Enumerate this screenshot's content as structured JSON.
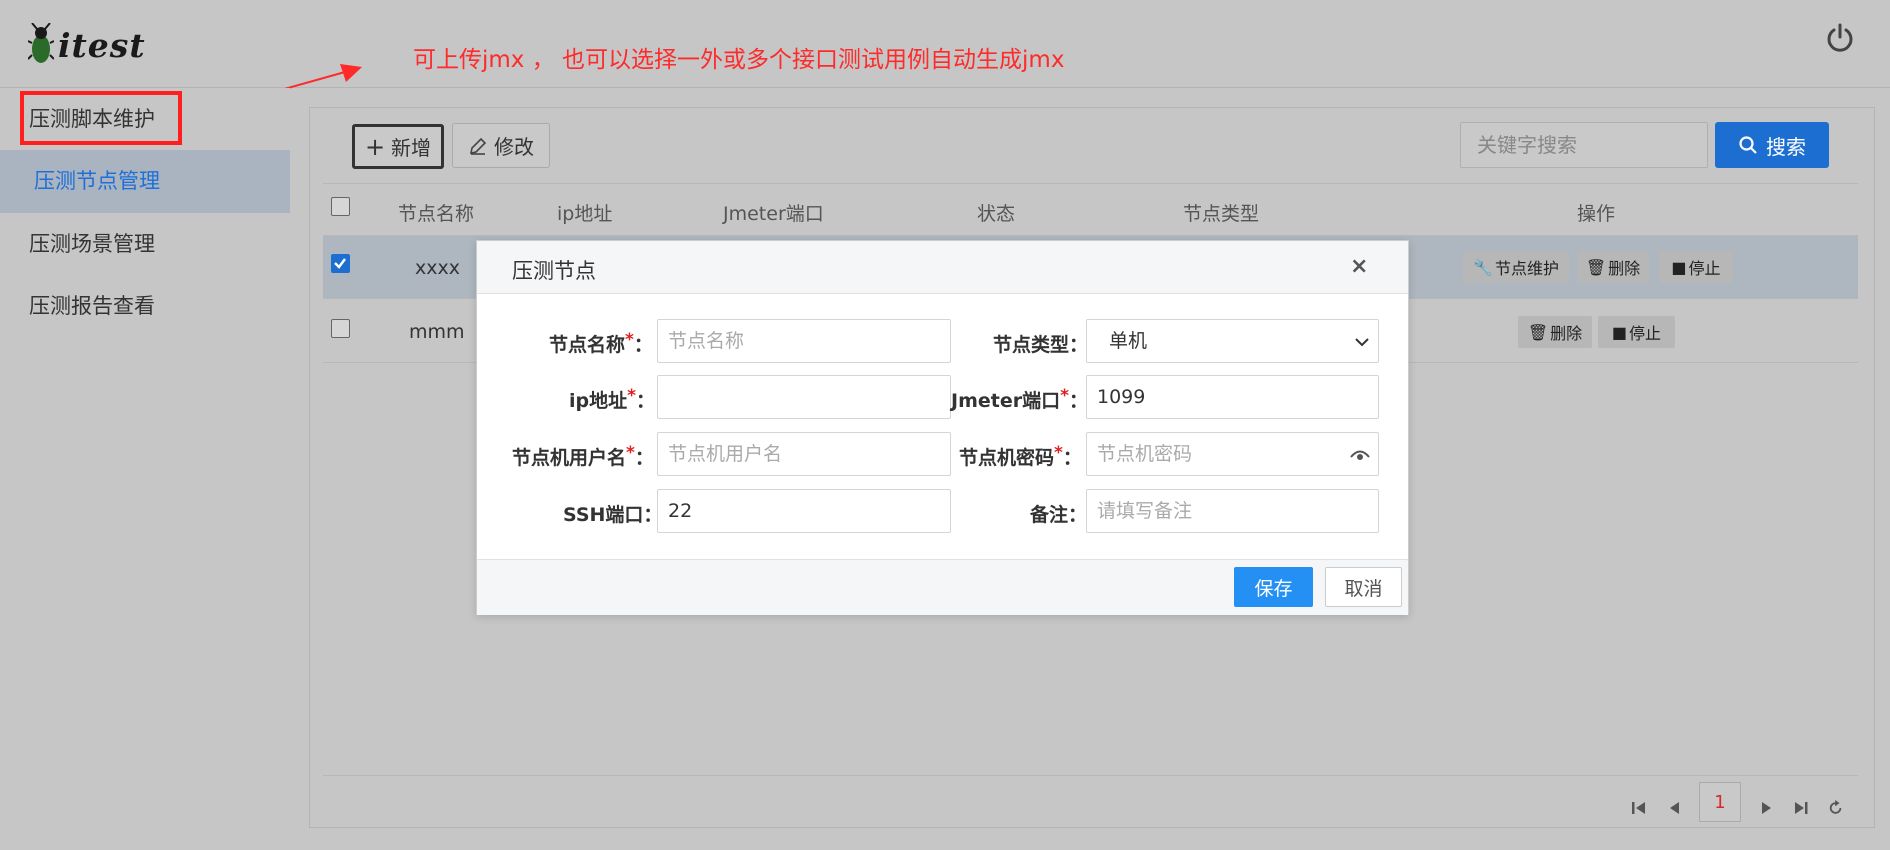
{
  "app": {
    "logo_text": "itest"
  },
  "annotation": {
    "text": "可上传jmx ，  也可以选择一外或多个接口测试用例自动生成jmx",
    "color": "#ff2a2a"
  },
  "sidebar": {
    "items": [
      {
        "label": "压测脚本维护",
        "highlighted": true
      },
      {
        "label": "压测节点管理",
        "active": true
      },
      {
        "label": "压测场景管理"
      },
      {
        "label": "压测报告查看"
      }
    ]
  },
  "toolbar": {
    "add_label": "新增",
    "edit_label": "修改",
    "search_placeholder": "关键字搜索",
    "search_label": "搜索"
  },
  "table": {
    "columns": [
      "节点名称",
      "ip地址",
      "Jmeter端口",
      "状态",
      "节点类型",
      "操作"
    ],
    "rows": [
      {
        "name": "xxxx",
        "checked": true,
        "actions": [
          "节点维护",
          "删除",
          "停止"
        ]
      },
      {
        "name": "mmm",
        "checked": false,
        "actions": [
          "删除",
          "停止"
        ]
      }
    ]
  },
  "pagination": {
    "current_page": "1"
  },
  "modal": {
    "title": "压测节点",
    "close": "×",
    "fields": {
      "node_name": {
        "label": "节点名称",
        "required": true,
        "value": "",
        "placeholder": "节点名称"
      },
      "node_type": {
        "label": "节点类型",
        "required": false,
        "value": "单机"
      },
      "ip": {
        "label": "ip地址",
        "required": true,
        "value": "",
        "placeholder": ""
      },
      "jmeter_port": {
        "label": "Jmeter端口",
        "required": true,
        "value": "1099"
      },
      "node_user": {
        "label": "节点机用户名",
        "required": true,
        "value": "",
        "placeholder": "节点机用户名"
      },
      "node_password": {
        "label": "节点机密码",
        "required": true,
        "value": "",
        "placeholder": "节点机密码"
      },
      "ssh_port": {
        "label": "SSH端口",
        "required": false,
        "value": "22"
      },
      "remark": {
        "label": "备注",
        "required": false,
        "value": "",
        "placeholder": "请填写备注"
      }
    },
    "save_label": "保存",
    "cancel_label": "取消"
  },
  "colors": {
    "primary": "#1c6fd0",
    "save": "#2590f4",
    "required": "#e02020"
  }
}
